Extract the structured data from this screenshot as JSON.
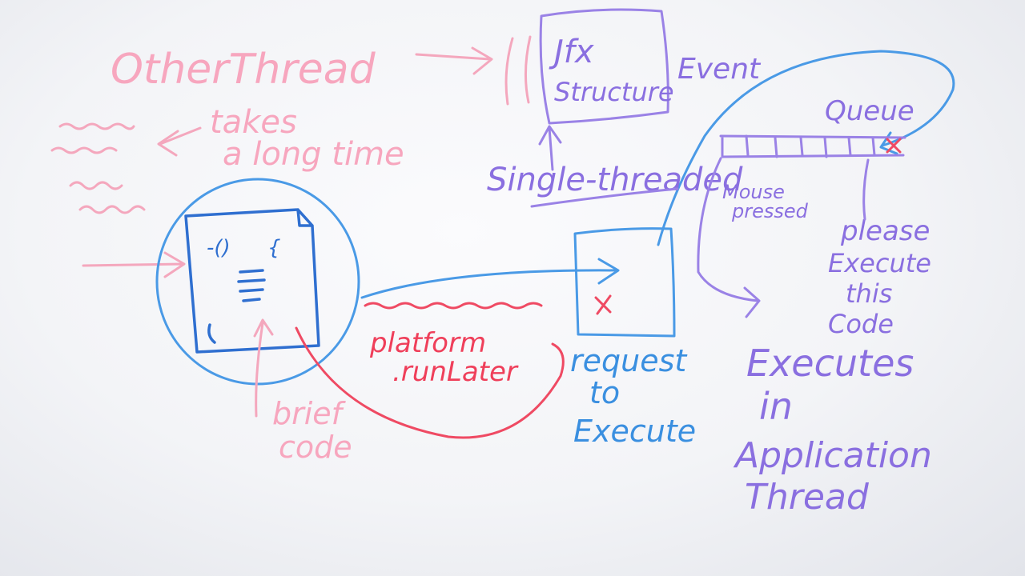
{
  "labels": {
    "other_thread": "OtherThread",
    "takes_line1": "takes",
    "takes_line2": "a long time",
    "jfx_line1": "Jfx",
    "jfx_line2": "Structure",
    "event": "Event",
    "queue": "Queue",
    "single_threaded": "Single-threaded",
    "mouse_line1": "Mouse",
    "mouse_line2": "pressed",
    "please_line1": "please",
    "please_line2": "Execute",
    "please_line3": "this",
    "please_line4": "Code",
    "platform_line1": "platform",
    "platform_line2": ".runLater",
    "request_line1": "request",
    "request_line2": "to",
    "request_line3": "Execute",
    "executes_line1": "Executes",
    "executes_line2": "in",
    "executes_line3": "Application",
    "executes_line4": "Thread",
    "brief_line1": "brief",
    "brief_line2": "code",
    "doc_method": "-()",
    "doc_brace": "{"
  },
  "colors": {
    "pink": "#f2a0b8",
    "red": "#ef3f5a",
    "blue": "#3a8fe0",
    "navy": "#2f6fd0",
    "purple": "#8a6fe0"
  }
}
